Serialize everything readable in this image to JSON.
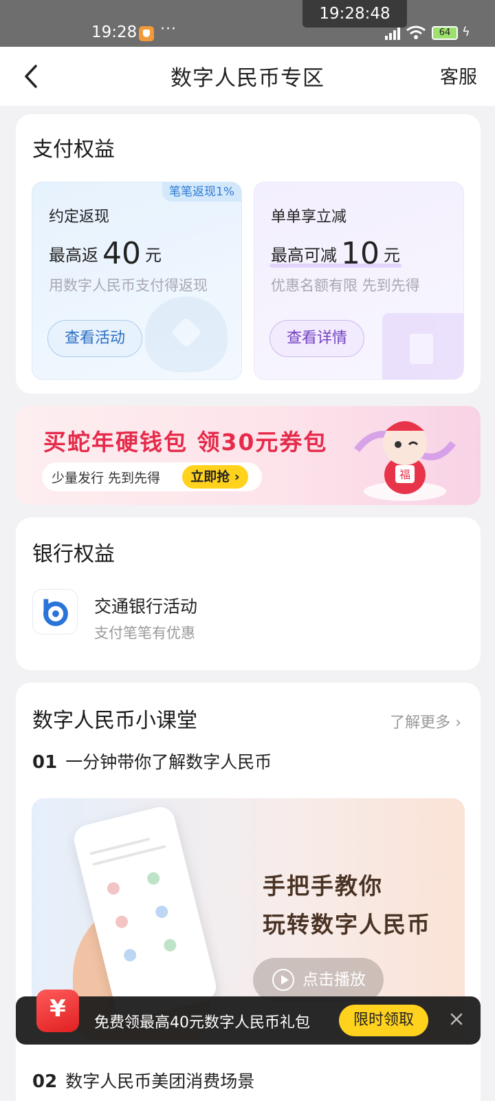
{
  "status_bar": {
    "time": "19:28",
    "center_clock": "19:28:48",
    "dots": "···",
    "battery": "64",
    "network": "HD"
  },
  "header": {
    "title": "数字人民币专区",
    "service_label": "客服"
  },
  "pay_benefits": {
    "title": "支付权益",
    "left": {
      "tag": "笔笔返现1%",
      "name": "约定返现",
      "amount_prefix": "最高返",
      "amount_value": "40",
      "amount_unit": "元",
      "desc": "用数字人民币支付得返现",
      "button": "查看活动"
    },
    "right": {
      "name": "单单享立减",
      "amount_prefix": "最高可减",
      "amount_value": "10",
      "amount_unit": "元",
      "desc": "优惠名额有限 先到先得",
      "button": "查看详情"
    }
  },
  "banner": {
    "title": "买蛇年硬钱包 领30元券包",
    "subtitle": "少量发行 先到先得",
    "cta": "立即抢",
    "mascot_text": "福"
  },
  "bank_benefits": {
    "title": "银行权益",
    "item": {
      "name": "交通银行活动",
      "desc": "支付笔笔有优惠"
    }
  },
  "classroom": {
    "title": "数字人民币小课堂",
    "more": "了解更多",
    "lessons": [
      {
        "num": "01",
        "title": "一分钟带你了解数字人民币"
      },
      {
        "num": "02",
        "title": "数字人民币美团消费场景"
      }
    ],
    "video": {
      "headline_line1": "手把手教你",
      "headline_line2": "玩转数字人民币",
      "play_label": "点击播放"
    }
  },
  "toast": {
    "text": "免费领最高40元数字人民币礼包",
    "button": "限时领取"
  },
  "colors": {
    "accent_red": "#e62a4a",
    "accent_yellow": "#ffd21e",
    "blue": "#2a6fc4",
    "purple": "#7440c2"
  }
}
